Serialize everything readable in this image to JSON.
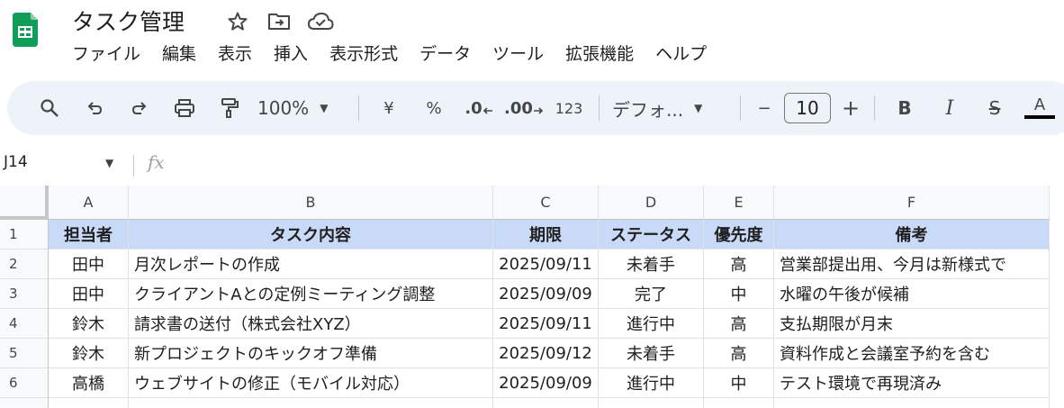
{
  "app": {
    "title": "タスク管理"
  },
  "menu": [
    "ファイル",
    "編集",
    "表示",
    "挿入",
    "表示形式",
    "データ",
    "ツール",
    "拡張機能",
    "ヘルプ"
  ],
  "toolbar": {
    "zoom": "100%",
    "currency": "¥",
    "percent": "%",
    "decrease_decimal": ".0",
    "increase_decimal": ".00",
    "number_format": "123",
    "font": "デフォ...",
    "minus": "−",
    "font_size": "10",
    "plus": "+",
    "bold": "B",
    "italic": "I",
    "strike": "S",
    "text_color": "A",
    "text_color_value": "#000000"
  },
  "formula_bar": {
    "cell_ref": "J14",
    "fx": "fx"
  },
  "colors": {
    "header_fill": "#c9daf8",
    "toolbar_bg": "#eef2f9",
    "sheets_green": "#0f9d58"
  },
  "sheet": {
    "columns": [
      "A",
      "B",
      "C",
      "D",
      "E",
      "F"
    ],
    "rows": [
      "1",
      "2",
      "3",
      "4",
      "5",
      "6"
    ],
    "header": [
      "担当者",
      "タスク内容",
      "期限",
      "ステータス",
      "優先度",
      "備考"
    ],
    "data": [
      [
        "田中",
        "月次レポートの作成",
        "2025/09/11",
        "未着手",
        "高",
        "営業部提出用、今月は新様式で"
      ],
      [
        "田中",
        "クライアントAとの定例ミーティング調整",
        "2025/09/09",
        "完了",
        "中",
        "水曜の午後が候補"
      ],
      [
        "鈴木",
        "請求書の送付（株式会社XYZ）",
        "2025/09/11",
        "進行中",
        "高",
        "支払期限が月末"
      ],
      [
        "鈴木",
        "新プロジェクトのキックオフ準備",
        "2025/09/12",
        "未着手",
        "高",
        "資料作成と会議室予約を含む"
      ],
      [
        "高橋",
        "ウェブサイトの修正（モバイル対応）",
        "2025/09/09",
        "進行中",
        "中",
        "テスト環境で再現済み"
      ]
    ]
  }
}
